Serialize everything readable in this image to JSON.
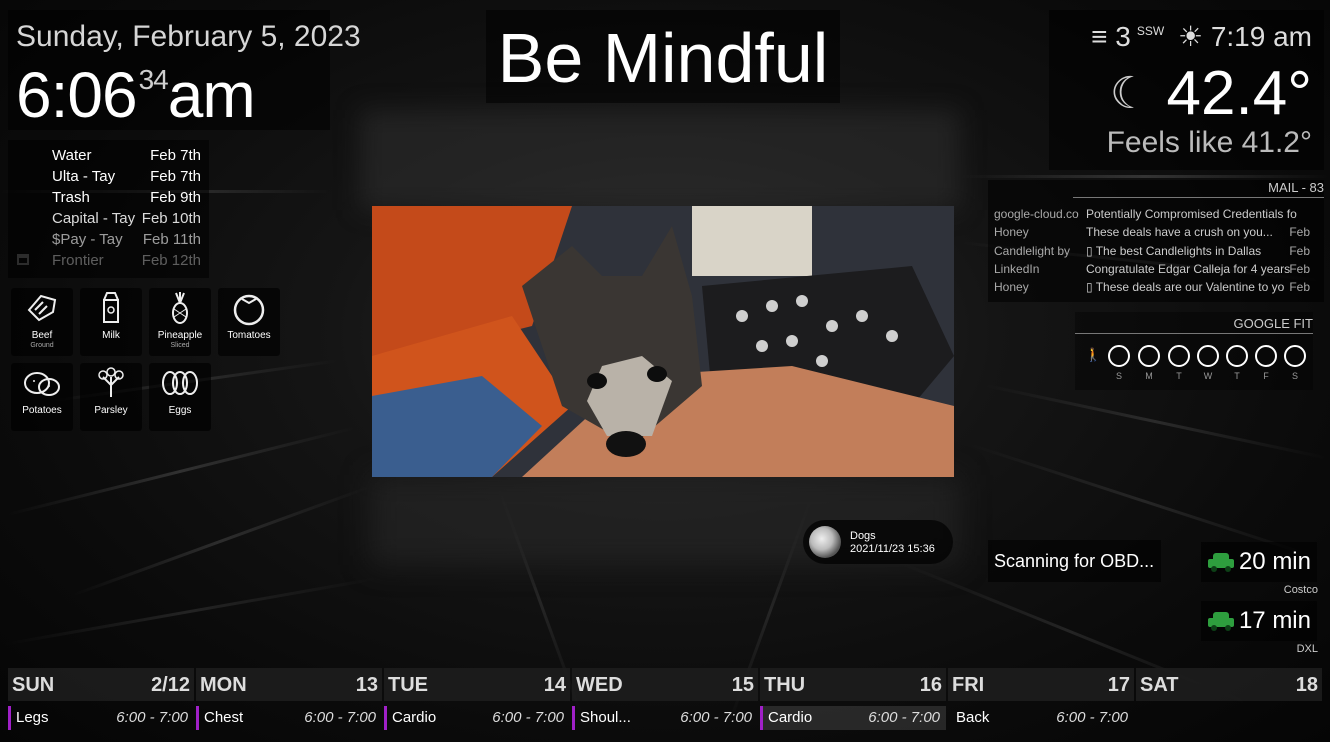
{
  "clock": {
    "date": "Sunday, February 5, 2023",
    "time": "6:06",
    "seconds": "34",
    "ampm": "am"
  },
  "quote": "Be Mindful",
  "chores": [
    {
      "name": "Water",
      "date": "Feb 7th"
    },
    {
      "name": "Ulta - Tay",
      "date": "Feb 7th"
    },
    {
      "name": "Trash",
      "date": "Feb 9th"
    },
    {
      "name": "Capital - Tay",
      "date": "Feb 10th"
    },
    {
      "name": "$Pay - Tay",
      "date": "Feb 11th"
    },
    {
      "name": "Frontier",
      "date": "Feb 12th"
    }
  ],
  "groceries": [
    {
      "label": "Beef",
      "sub": "Ground",
      "icon": "meat-icon"
    },
    {
      "label": "Milk",
      "sub": "",
      "icon": "milk-carton-icon"
    },
    {
      "label": "Pineapple",
      "sub": "Sliced",
      "icon": "pineapple-icon"
    },
    {
      "label": "Tomatoes",
      "sub": "",
      "icon": "tomato-icon"
    },
    {
      "label": "Potatoes",
      "sub": "",
      "icon": "potato-icon"
    },
    {
      "label": "Parsley",
      "sub": "",
      "icon": "parsley-icon"
    },
    {
      "label": "Eggs",
      "sub": "",
      "icon": "eggs-icon"
    }
  ],
  "photo": {
    "album": "Dogs",
    "timestamp": "2021/11/23 15:36"
  },
  "weather": {
    "wind_speed": "3",
    "wind_dir": "SSW",
    "sunrise": "7:19 am",
    "temp": "42.4°",
    "feels_like": "Feels like 41.2°"
  },
  "mail": {
    "title": "MAIL - 83",
    "messages": [
      {
        "from": "google-cloud.co",
        "subject": "Potentially Compromised Credentials fo",
        "date": ""
      },
      {
        "from": "Honey",
        "subject": "These deals have a crush on you...",
        "date": "Feb"
      },
      {
        "from": "Candlelight by",
        "subject": "▯ The best Candlelights in Dallas",
        "date": "Feb"
      },
      {
        "from": "LinkedIn",
        "subject": "Congratulate Edgar Calleja for 4 years",
        "date": "Feb"
      },
      {
        "from": "Honey",
        "subject": "▯ These deals are our Valentine to yo",
        "date": "Feb"
      }
    ]
  },
  "fit": {
    "title": "GOOGLE FIT",
    "days": [
      "S",
      "M",
      "T",
      "W",
      "T",
      "F",
      "S"
    ]
  },
  "obd": {
    "status": "Scanning for OBD..."
  },
  "travel": [
    {
      "time": "20 min",
      "dest": "Costco"
    },
    {
      "time": "17 min",
      "dest": "DXL"
    }
  ],
  "week": [
    {
      "day": "SUN",
      "date": "2/12",
      "event": "Legs",
      "time": "6:00 - 7:00"
    },
    {
      "day": "MON",
      "date": "13",
      "event": "Chest",
      "time": "6:00 - 7:00"
    },
    {
      "day": "TUE",
      "date": "14",
      "event": "Cardio",
      "time": "6:00 - 7:00"
    },
    {
      "day": "WED",
      "date": "15",
      "event": "Shoul...",
      "time": "6:00 - 7:00"
    },
    {
      "day": "THU",
      "date": "16",
      "event": "Cardio",
      "time": "6:00 - 7:00"
    },
    {
      "day": "FRI",
      "date": "17",
      "event": "Back",
      "time": "6:00 - 7:00"
    },
    {
      "day": "SAT",
      "date": "18",
      "event": "",
      "time": ""
    }
  ],
  "colors": {
    "event_accent": "#a020c8",
    "car": "#2e9e3e"
  }
}
